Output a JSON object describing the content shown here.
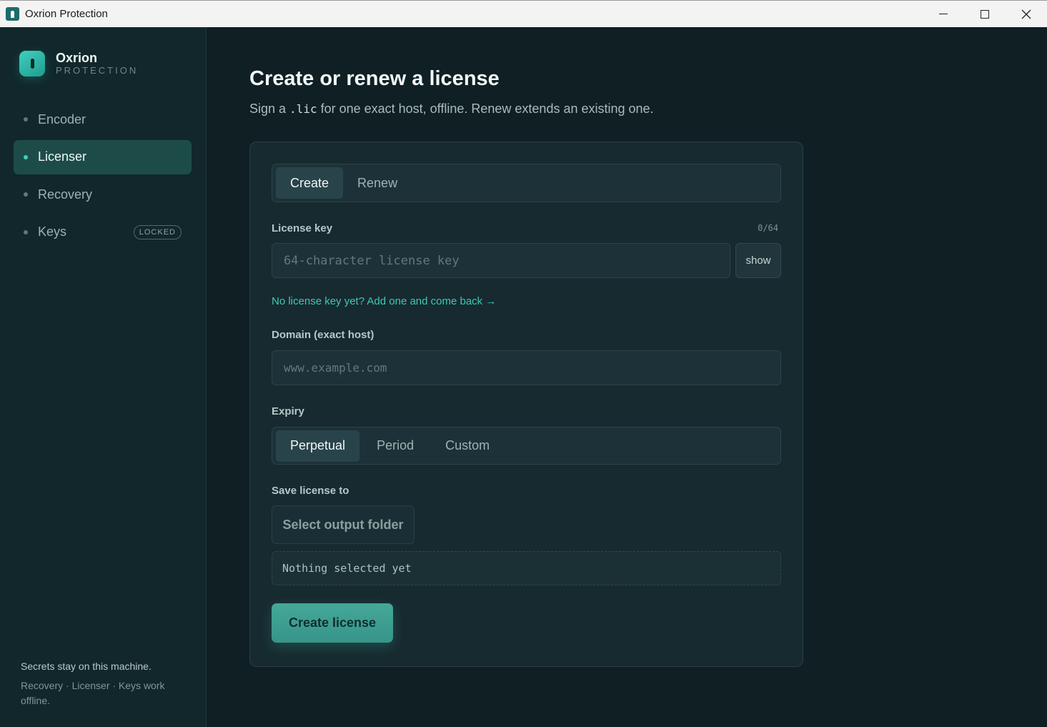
{
  "window": {
    "title": "Oxrion Protection",
    "controls": [
      "minimize-icon",
      "maximize-icon",
      "close-icon"
    ]
  },
  "brand": {
    "name": "Oxrion",
    "subtitle": "PROTECTION"
  },
  "sidebar": {
    "items": [
      {
        "label": "Encoder",
        "active": false
      },
      {
        "label": "Licenser",
        "active": true
      },
      {
        "label": "Recovery",
        "active": false
      },
      {
        "label": "Keys",
        "active": false,
        "badge": "LOCKED"
      }
    ],
    "footer_line1": "Secrets stay on this machine.",
    "footer_line2": "Recovery · Licenser · Keys work offline."
  },
  "page": {
    "title": "Create or renew a license",
    "subtitle_before": "Sign a ",
    "subtitle_code": ".lic",
    "subtitle_after": " for one exact host, offline. Renew extends an existing one."
  },
  "form": {
    "mode_tabs": [
      {
        "label": "Create",
        "active": true
      },
      {
        "label": "Renew",
        "active": false
      }
    ],
    "license_key": {
      "label": "License key",
      "counter": "0/64",
      "value": "",
      "placeholder": "64-character license key",
      "show_label": "show"
    },
    "add_key_link": "No license key yet? Add one and come back →",
    "domain": {
      "label": "Domain (exact host)",
      "value": "",
      "placeholder": "www.example.com"
    },
    "expiry": {
      "label": "Expiry",
      "options": [
        {
          "label": "Perpetual",
          "active": true
        },
        {
          "label": "Period",
          "active": false
        },
        {
          "label": "Custom",
          "active": false
        }
      ]
    },
    "save": {
      "label": "Save license to",
      "button": "Select output folder",
      "path": "Nothing selected yet"
    },
    "submit": "Create license"
  },
  "colors": {
    "accent": "#3fc8b6",
    "background": "#0f1f24",
    "sidebar": "#11272b",
    "card": "#172a30",
    "active_nav": "#1d4c48",
    "primary_button": "#3c9d90"
  }
}
